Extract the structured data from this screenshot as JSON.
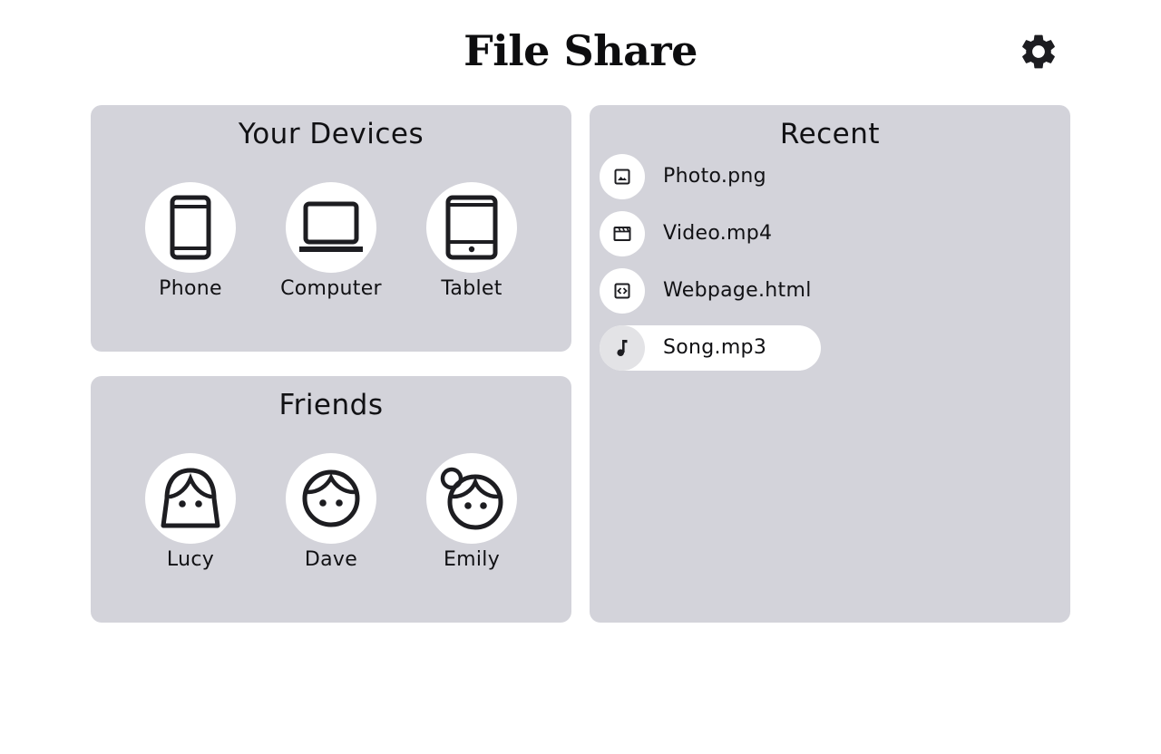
{
  "header": {
    "title": "File Share",
    "settings_icon": "gear-icon"
  },
  "devices": {
    "title": "Your Devices",
    "items": [
      {
        "label": "Phone",
        "icon": "phone-icon"
      },
      {
        "label": "Computer",
        "icon": "laptop-icon"
      },
      {
        "label": "Tablet",
        "icon": "tablet-icon"
      }
    ]
  },
  "friends": {
    "title": "Friends",
    "items": [
      {
        "label": "Lucy",
        "icon": "girl-face-icon"
      },
      {
        "label": "Dave",
        "icon": "boy-face-icon"
      },
      {
        "label": "Emily",
        "icon": "girl-bun-face-icon"
      }
    ]
  },
  "recent": {
    "title": "Recent",
    "items": [
      {
        "name": "Photo.png",
        "icon": "image-icon",
        "selected": false
      },
      {
        "name": "Video.mp4",
        "icon": "video-icon",
        "selected": false
      },
      {
        "name": "Webpage.html",
        "icon": "code-icon",
        "selected": false
      },
      {
        "name": "Song.mp3",
        "icon": "music-note-icon",
        "selected": true
      }
    ]
  },
  "colors": {
    "panel_background": "#d3d3da",
    "page_background": "#ffffff",
    "icon_stroke": "#1d1d21",
    "selected_item_background": "#ffffff"
  }
}
